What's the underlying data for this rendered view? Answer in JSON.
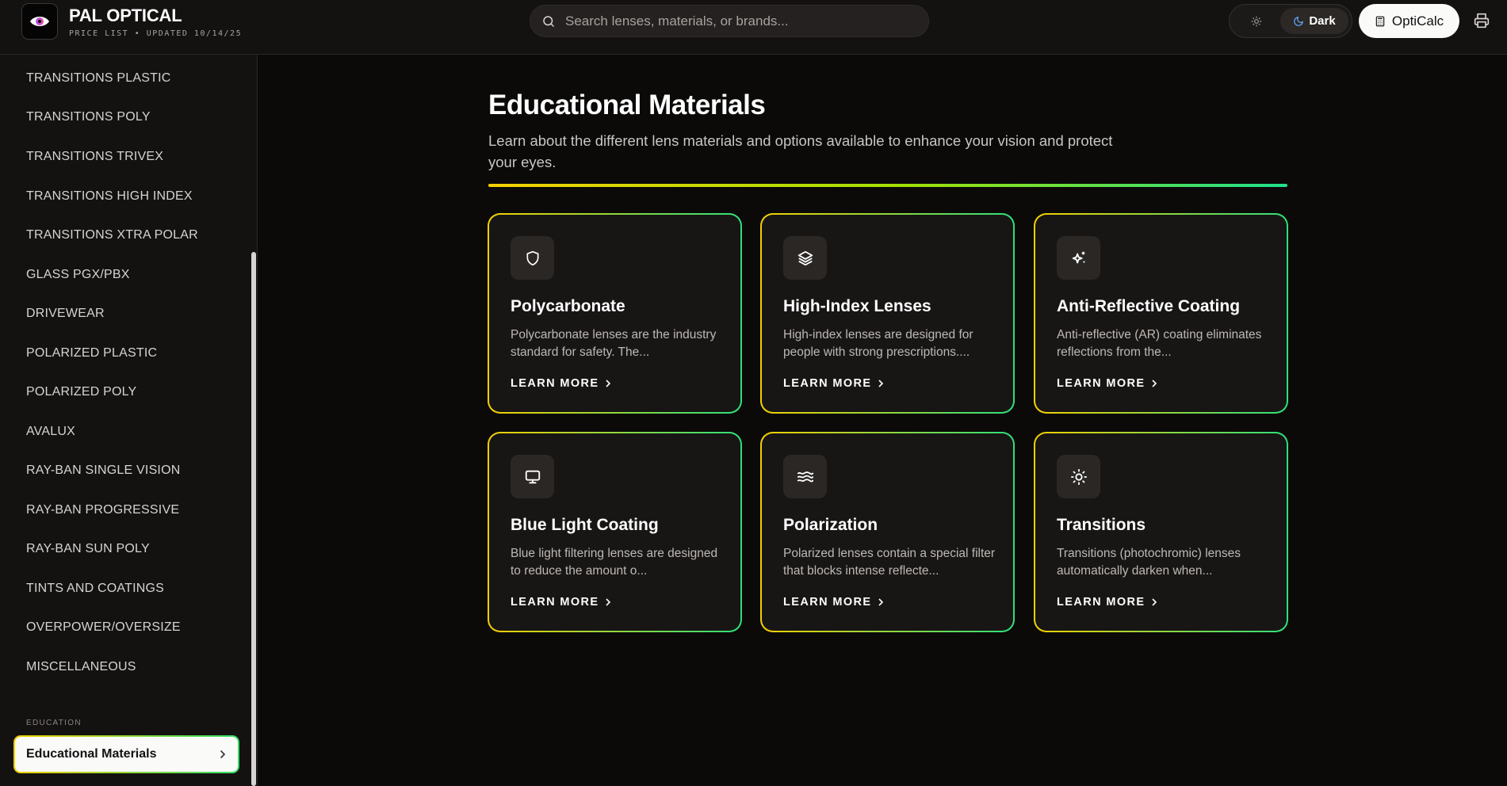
{
  "header": {
    "brand_name": "PAL OPTICAL",
    "brand_subtitle": "PRICE LIST • UPDATED 10/14/25",
    "search_placeholder": "Search lenses, materials, or brands...",
    "theme_dark_label": "Dark",
    "calc_label": "OptiCalc",
    "icons": {
      "logo": "eye-icon",
      "search": "search-icon",
      "light": "sun-icon",
      "dark": "moon-icon",
      "calc": "calculator-icon",
      "print": "printer-icon"
    }
  },
  "sidebar": {
    "items": [
      "TRANSITIONS PLASTIC",
      "TRANSITIONS POLY",
      "TRANSITIONS TRIVEX",
      "TRANSITIONS HIGH INDEX",
      "TRANSITIONS XTRA POLAR",
      "GLASS PGX/PBX",
      "DRIVEWEAR",
      "POLARIZED PLASTIC",
      "POLARIZED POLY",
      "AVALUX",
      "RAY-BAN SINGLE VISION",
      "RAY-BAN PROGRESSIVE",
      "RAY-BAN SUN POLY",
      "TINTS AND COATINGS",
      "OVERPOWER/OVERSIZE",
      "MISCELLANEOUS"
    ],
    "section_label": "EDUCATION",
    "active_item": "Educational Materials"
  },
  "main": {
    "title": "Educational Materials",
    "description": "Learn about the different lens materials and options available to enhance your vision and protect your eyes.",
    "accent_gradient": [
      "#f4d000",
      "#1fe08c"
    ],
    "cards": [
      {
        "icon": "shield-icon",
        "title": "Polycarbonate",
        "text": "Polycarbonate lenses are the industry standard for safety. The...",
        "link": "LEARN MORE"
      },
      {
        "icon": "layers-icon",
        "title": "High-Index Lenses",
        "text": "High-index lenses are designed for people with strong prescriptions....",
        "link": "LEARN MORE"
      },
      {
        "icon": "sparkles-icon",
        "title": "Anti-Reflective Coating",
        "text": "Anti-reflective (AR) coating eliminates reflections from the...",
        "link": "LEARN MORE"
      },
      {
        "icon": "monitor-icon",
        "title": "Blue Light Coating",
        "text": "Blue light filtering lenses are designed to reduce the amount o...",
        "link": "LEARN MORE"
      },
      {
        "icon": "waves-icon",
        "title": "Polarization",
        "text": "Polarized lenses contain a special filter that blocks intense reflecte...",
        "link": "LEARN MORE"
      },
      {
        "icon": "sun-icon",
        "title": "Transitions",
        "text": "Transitions (photochromic) lenses automatically darken when...",
        "link": "LEARN MORE"
      }
    ]
  }
}
